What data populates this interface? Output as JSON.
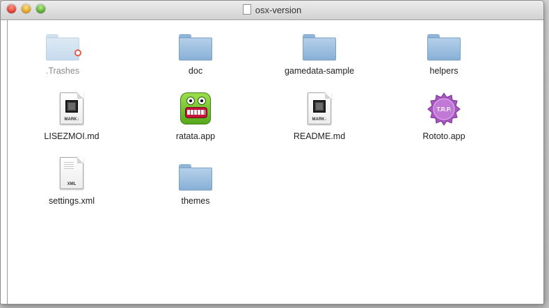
{
  "window": {
    "title": "osx-version"
  },
  "items": [
    {
      "label": ".Trashes",
      "kind": "folder",
      "icon": "folder-icon-hidden"
    },
    {
      "label": "doc",
      "kind": "folder",
      "icon": "folder-icon"
    },
    {
      "label": "gamedata-sample",
      "kind": "folder",
      "icon": "folder-icon"
    },
    {
      "label": "helpers",
      "kind": "folder",
      "icon": "folder-icon"
    },
    {
      "label": "LISEZMOI.md",
      "kind": "markdown",
      "icon": "markdown-file-icon",
      "ext": "MARK↓"
    },
    {
      "label": "ratata.app",
      "kind": "app",
      "icon": "ratata-app-icon"
    },
    {
      "label": "README.md",
      "kind": "markdown",
      "icon": "markdown-file-icon",
      "ext": "MARK↓"
    },
    {
      "label": "Rototo.app",
      "kind": "app",
      "icon": "rototo-app-icon",
      "badge_text": "T.R.P."
    },
    {
      "label": "settings.xml",
      "kind": "xml",
      "icon": "xml-file-icon",
      "ext": "XML"
    },
    {
      "label": "themes",
      "kind": "folder",
      "icon": "folder-icon"
    }
  ],
  "colors": {
    "close": "#d8372a",
    "minimize": "#d99a17",
    "maximize": "#4ea12a",
    "folder": "#88b0d6",
    "rototo_badge": "#a855c0"
  }
}
